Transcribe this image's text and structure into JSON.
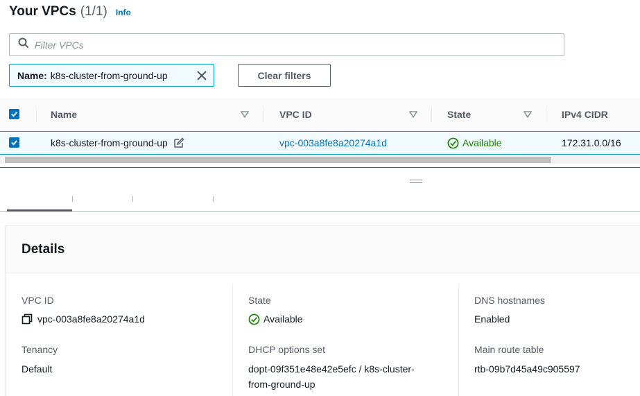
{
  "header": {
    "title": "Your VPCs",
    "count": "(1/1)",
    "info": "Info"
  },
  "search": {
    "placeholder": "Filter VPCs",
    "value": ""
  },
  "filter_chip": {
    "key": "Name:",
    "value": "k8s-cluster-from-ground-up"
  },
  "clear_filters": "Clear filters",
  "table": {
    "columns": [
      "Name",
      "VPC ID",
      "State",
      "IPv4 CIDR"
    ],
    "rows": [
      {
        "name": "k8s-cluster-from-ground-up",
        "vpc_id": "vpc-003a8fe8a20274a1d",
        "state": "Available",
        "ipv4_cidr": "172.31.0.0/16",
        "selected": true
      }
    ]
  },
  "details": {
    "title": "Details",
    "fields": {
      "vpc_id": {
        "label": "VPC ID",
        "value": "vpc-003a8fe8a20274a1d"
      },
      "state": {
        "label": "State",
        "value": "Available"
      },
      "dns_hostnames": {
        "label": "DNS hostnames",
        "value": "Enabled"
      },
      "tenancy": {
        "label": "Tenancy",
        "value": "Default"
      },
      "dhcp": {
        "label": "DHCP options set",
        "value_line1": "dopt-09f351e48e42e5efc / k8s-cluster-",
        "value_line2": "from-ground-up"
      },
      "main_route_table": {
        "label": "Main route table",
        "value": "rtb-09b7d45a49c905597"
      }
    }
  },
  "colors": {
    "link": "#0073bb",
    "success": "#1d8102",
    "selection": "#f1faff",
    "selection_border": "#00a1c9"
  },
  "icons": [
    "search-icon",
    "close-icon",
    "checkbox-checked-icon",
    "sort-icon",
    "edit-icon",
    "status-ok-icon",
    "copy-icon",
    "drag-handle-icon"
  ]
}
